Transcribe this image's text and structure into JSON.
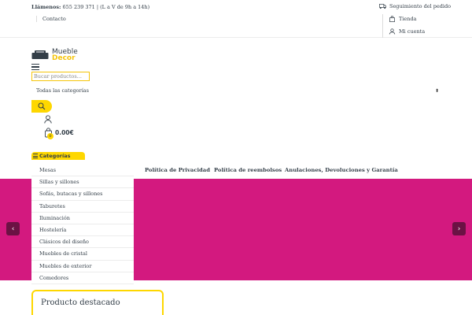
{
  "topbar": {
    "call_label": "Llámenos:",
    "call_text": "655 239 371 | (L a V de 9h a 14h)",
    "contact": "Contacto",
    "tracking": "Seguimiento del pedido",
    "store": "Tienda",
    "account": "Mi cuenta"
  },
  "logo": {
    "line1": "Mueble",
    "line2": "Decor"
  },
  "search": {
    "placeholder": "Bucar productos...",
    "category": "Todas las categorías"
  },
  "cart": {
    "count": "0",
    "total": "0.00€"
  },
  "categories": {
    "title": "Categorías",
    "items": [
      "Mesas",
      "Sillas y sillones",
      "Sofás, butacas y sillones",
      "Taburetes",
      "Iluminación",
      "Hostelería",
      "Clásicos del diseño",
      "Muebles de cristal",
      "Muebles de exterior",
      "Comedores"
    ]
  },
  "nav": {
    "privacy": "Política de Privacidad",
    "refunds": "Política de reembolsos",
    "cancellations": "Anulaciones, Devoluciones y Garantía"
  },
  "hero": {
    "prev": "‹",
    "next": "›"
  },
  "featured": {
    "title": "Producto destacado"
  },
  "colors": {
    "accent": "#fed700",
    "hero": "#d3197f",
    "arrow": "#6b1244"
  }
}
